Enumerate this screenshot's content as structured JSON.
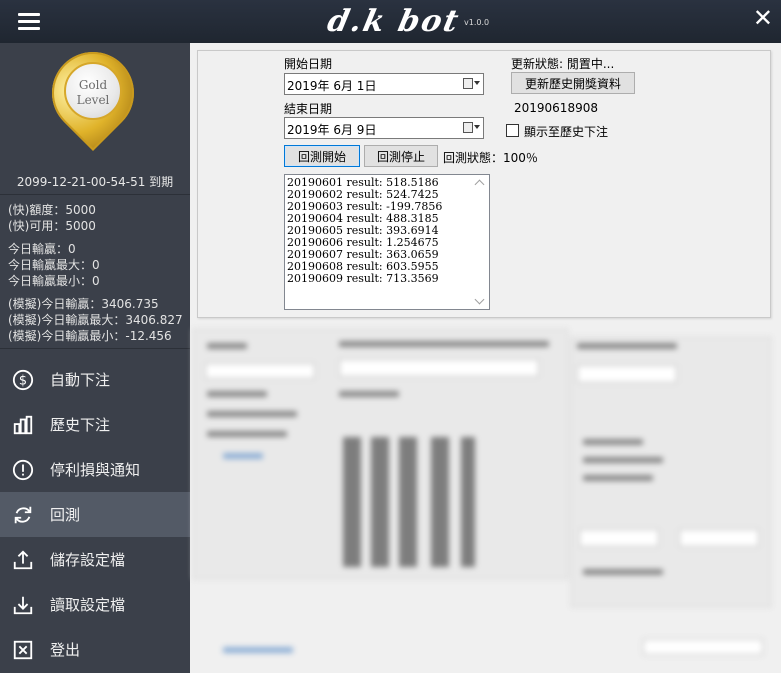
{
  "app": {
    "logo_text": "d.k bot",
    "version": "v1.0.0"
  },
  "sidebar": {
    "badge": {
      "line1": "Gold",
      "line2": "Level"
    },
    "expire": "2099-12-21-00-54-51 到期",
    "quota": [
      "(快)額度：5000",
      "(快)可用：5000"
    ],
    "today": [
      "今日輸贏：0",
      "今日輸贏最大：0",
      "今日輸贏最小：0"
    ],
    "sim": [
      "(模擬)今日輸贏：3406.735",
      "(模擬)今日輸贏最大：3406.827",
      "(模擬)今日輸贏最小：-12.456"
    ],
    "nav": [
      {
        "label": "自動下注",
        "icon": "dollar-circle-icon"
      },
      {
        "label": "歷史下注",
        "icon": "bar-chart-icon"
      },
      {
        "label": "停利損與通知",
        "icon": "exclamation-circle-icon"
      },
      {
        "label": "回測",
        "icon": "refresh-icon"
      },
      {
        "label": "儲存設定檔",
        "icon": "upload-icon"
      },
      {
        "label": "讀取設定檔",
        "icon": "download-icon"
      },
      {
        "label": "登出",
        "icon": "close-box-icon"
      }
    ],
    "active_index": 3
  },
  "backtest": {
    "start_label": "開始日期",
    "start_value": "2019年  6月  1日",
    "end_label": "結束日期",
    "end_value": "2019年  6月  9日",
    "start_button": "回測開始",
    "stop_button": "回測停止",
    "status": "回測狀態：100％",
    "update_status": "更新狀態: 閒置中...",
    "update_button": "更新歷史開獎資料",
    "update_id": "20190618908",
    "show_history_label": "顯示至歷史下注",
    "results": [
      "20190601 result: 518.5186",
      "20190602 result: 524.7425",
      "20190603 result: -199.7856",
      "20190604 result: 488.3185",
      "20190605 result: 393.6914",
      "20190606 result: 1.254675",
      "20190607 result: 363.0659",
      "20190608 result: 603.5955",
      "20190609 result: 713.3569"
    ]
  }
}
